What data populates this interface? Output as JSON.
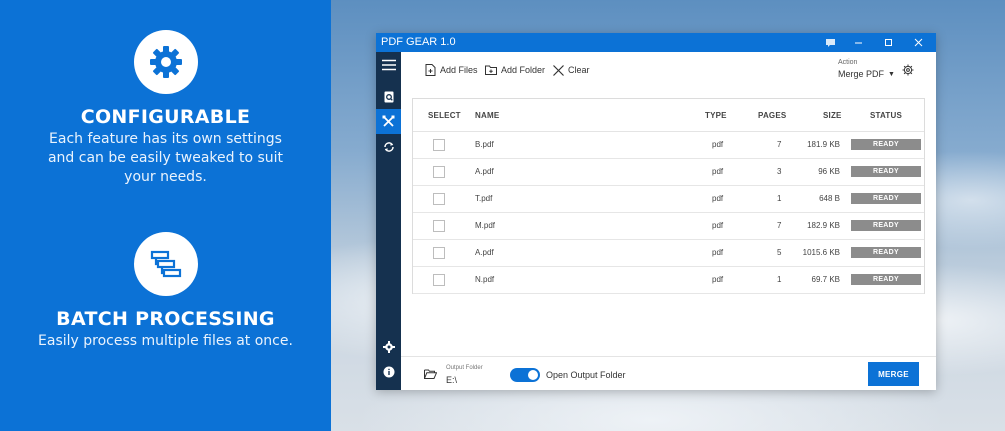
{
  "promo": {
    "features": [
      {
        "icon": "gear-icon",
        "title": "CONFIGURABLE",
        "desc": "Each feature has its own settings and can be easily tweaked to suit your needs."
      },
      {
        "icon": "stack-icon",
        "title": "BATCH PROCESSING",
        "desc": "Easily process multiple files at once."
      }
    ]
  },
  "window": {
    "title": "PDF GEAR 1.0",
    "toolbar": {
      "add_files": "Add Files",
      "add_folder": "Add Folder",
      "clear": "Clear",
      "action_label": "Action",
      "action_value": "Merge PDF"
    },
    "columns": {
      "select": "SELECT",
      "name": "NAME",
      "type": "TYPE",
      "pages": "PAGES",
      "size": "SIZE",
      "status": "STATUS"
    },
    "files": [
      {
        "name": "B.pdf",
        "type": "pdf",
        "pages": "7",
        "size": "181.9 KB",
        "status": "READY"
      },
      {
        "name": "A.pdf",
        "type": "pdf",
        "pages": "3",
        "size": "96 KB",
        "status": "READY"
      },
      {
        "name": "T.pdf",
        "type": "pdf",
        "pages": "1",
        "size": "648 B",
        "status": "READY"
      },
      {
        "name": "M.pdf",
        "type": "pdf",
        "pages": "7",
        "size": "182.9 KB",
        "status": "READY"
      },
      {
        "name": "A.pdf",
        "type": "pdf",
        "pages": "5",
        "size": "1015.6 KB",
        "status": "READY"
      },
      {
        "name": "N.pdf",
        "type": "pdf",
        "pages": "1",
        "size": "69.7 KB",
        "status": "READY"
      }
    ],
    "footer": {
      "output_label": "Output Folder",
      "output_value": "E:\\",
      "open_output_label": "Open Output Folder",
      "open_output_on": true,
      "merge_label": "MERGE"
    }
  },
  "colors": {
    "accent": "#0c72d6",
    "sidebar": "#15314f",
    "status_ready": "#8c8c8c"
  }
}
